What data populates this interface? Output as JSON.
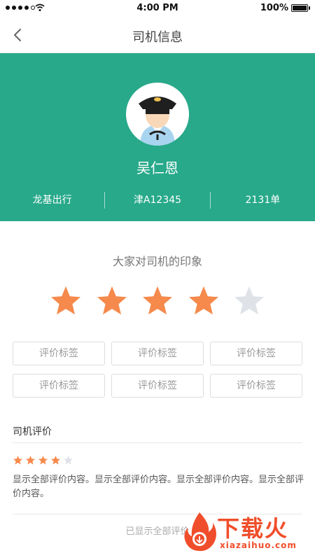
{
  "status_bar": {
    "time": "4:00 PM",
    "battery": "100%"
  },
  "nav": {
    "title": "司机信息"
  },
  "driver": {
    "name": "吴仁恩",
    "company": "龙基出行",
    "plate": "津A12345",
    "orders": "2131单"
  },
  "impression": {
    "title": "大家对司机的印象",
    "rating": 4,
    "max": 5,
    "tags": [
      "评价标签",
      "评价标签",
      "评价标签",
      "评价标签",
      "评价标签",
      "评价标签"
    ]
  },
  "reviews": {
    "heading": "司机评价",
    "items": [
      {
        "rating": 4,
        "text": "显示全部评价内容。显示全部评价内容。显示全部评价内容。显示全部评价内容。"
      }
    ],
    "all_shown": "已显示全部评价"
  },
  "colors": {
    "accent": "#27a98a",
    "star_on": "#f58a4c",
    "star_off": "#dfe3e8"
  },
  "watermark": {
    "name": "下载火",
    "url": "xiazaihuo.com"
  }
}
